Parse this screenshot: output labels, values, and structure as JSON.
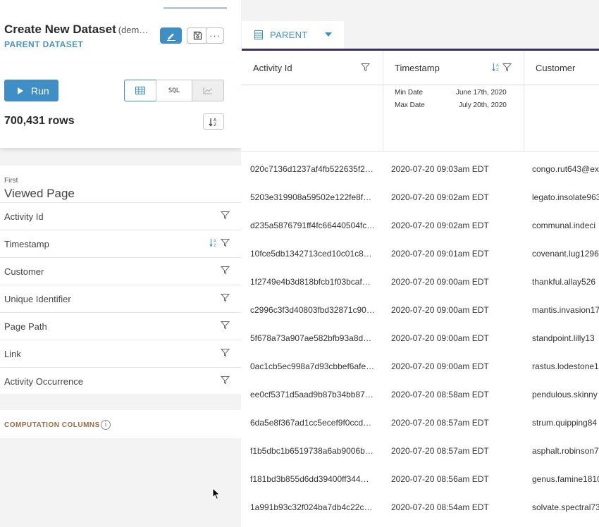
{
  "header": {
    "title": "Create New Dataset",
    "title_suffix": "(dem…",
    "subtitle": "PARENT DATASET"
  },
  "toolbar": {
    "edit_icon": "pencil-icon",
    "save_icon": "save-icon",
    "more_label": "···"
  },
  "run_panel": {
    "run_label": "Run",
    "views": [
      {
        "name": "table",
        "icon": "table-icon",
        "selected": true
      },
      {
        "name": "sql",
        "label": "SQL",
        "selected": false
      },
      {
        "name": "chart",
        "icon": "line-chart-icon",
        "selected": false
      }
    ],
    "row_count": "700,431 rows"
  },
  "activity": {
    "occurrence": "First",
    "name": "Viewed Page",
    "columns": [
      {
        "label": "Activity Id",
        "sorted": false
      },
      {
        "label": "Timestamp",
        "sorted": true
      },
      {
        "label": "Customer",
        "sorted": false
      },
      {
        "label": "Unique Identifier",
        "sorted": false
      },
      {
        "label": "Page Path",
        "sorted": false
      },
      {
        "label": "Link",
        "sorted": false
      },
      {
        "label": "Activity Occurrence",
        "sorted": false
      }
    ]
  },
  "computation": {
    "label": "COMPUTATION COLUMNS",
    "info_icon": "info-icon"
  },
  "table": {
    "tab_label": "PARENT",
    "columns": [
      "Activity Id",
      "Timestamp",
      "Customer"
    ],
    "stats": {
      "min_label": "Min Date",
      "min_value": "June 17th, 2020",
      "max_label": "Max Date",
      "max_value": "July 20th, 2020"
    },
    "rows": [
      [
        "020c7136d1237af4fb522635f2…",
        "2020-07-20 09:03am EDT",
        "congo.rut643@ex"
      ],
      [
        "5203e319908a59502e122fe8fc…",
        "2020-07-20 09:02am EDT",
        "legato.insolate963"
      ],
      [
        "d235a5876791ff4fc66440504fc…",
        "2020-07-20 09:02am EDT",
        "communal.indeci"
      ],
      [
        "10fce5db1342713ced10c01c8…",
        "2020-07-20 09:01am EDT",
        "covenant.lug1296"
      ],
      [
        "1f2749e4b3d818bfcb1f03bcaf…",
        "2020-07-20 09:00am EDT",
        "thankful.allay526"
      ],
      [
        "c2996c3f3d40803fbd32871c90…",
        "2020-07-20 09:00am EDT",
        "mantis.invasion17"
      ],
      [
        "5f678a73a907ae582bfb93a8d…",
        "2020-07-20 09:00am EDT",
        "standpoint.lilly13"
      ],
      [
        "0ac1cb5ec998a7d93cbbef6afe…",
        "2020-07-20 09:00am EDT",
        "rastus.lodestone1"
      ],
      [
        "ee0cf5371d5aad9b87b34bb87…",
        "2020-07-20 08:58am EDT",
        "pendulous.skinny"
      ],
      [
        "6da5e8f367ad1cc5ecef9f0ccd…",
        "2020-07-20 08:57am EDT",
        "strum.quipping84"
      ],
      [
        "f1b5dbc1b6519738a6ab9006b…",
        "2020-07-20 08:57am EDT",
        "asphalt.robinson7"
      ],
      [
        "f181bd3b855d6dd39400ff344…",
        "2020-07-20 08:56am EDT",
        "genus.famine1810"
      ],
      [
        "1a991b93c32f024ba7db4c22c…",
        "2020-07-20 08:54am EDT",
        "solvate.spectral73"
      ]
    ]
  },
  "colors": {
    "primary": "#3f8fc6",
    "tab_underline": "#3d2e5d",
    "computation_label": "#9a6a43"
  }
}
